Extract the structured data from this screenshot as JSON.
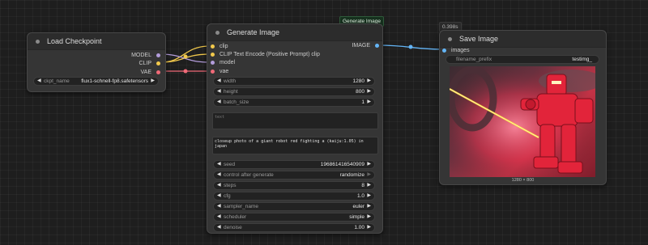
{
  "load_checkpoint": {
    "title": "Load Checkpoint",
    "outputs": [
      "MODEL",
      "CLIP",
      "VAE"
    ],
    "widget_label": "ckpt_name",
    "widget_value": "flux1-schnell-fp8.safetensors"
  },
  "generate": {
    "badge": "Generate Image",
    "title": "Generate Image",
    "inputs": [
      "clip",
      "CLIP Text Encode (Positive Prompt) clip",
      "model",
      "vae"
    ],
    "output": "IMAGE",
    "widgets_top": [
      {
        "label": "width",
        "value": "1280"
      },
      {
        "label": "height",
        "value": "800"
      },
      {
        "label": "batch_size",
        "value": "1"
      }
    ],
    "text_label": "text",
    "prompt": "closeup photo of a giant robot red fighting a (kaiju:1.05) in japan",
    "widgets_bottom": [
      {
        "label": "seed",
        "value": "196861416540909"
      },
      {
        "label": "control after generate",
        "value": "randomize"
      },
      {
        "label": "steps",
        "value": "8"
      },
      {
        "label": "cfg",
        "value": "1.0"
      },
      {
        "label": "sampler_name",
        "value": "euler"
      },
      {
        "label": "scheduler",
        "value": "simple"
      },
      {
        "label": "denoise",
        "value": "1.00"
      }
    ]
  },
  "save_image": {
    "timing": "0.398s",
    "title": "Save Image",
    "input": "images",
    "prefix_label": "filename_prefix",
    "prefix_value": "testimg_",
    "dims": "1280 × 800"
  },
  "colors": {
    "model": "#b39ddb",
    "clip": "#f2c94c",
    "vae": "#f06a78",
    "image": "#64b5f6"
  }
}
